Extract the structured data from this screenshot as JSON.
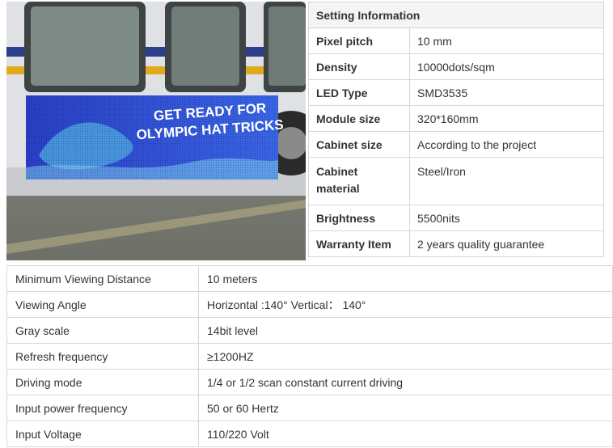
{
  "photo": {
    "sign_line1": "GET READY FOR",
    "sign_line2": "OLYMPIC HAT TRICKS"
  },
  "setting": {
    "header": "Setting Information",
    "rows": [
      {
        "key": "Pixel pitch",
        "value": "10 mm"
      },
      {
        "key": "Density",
        "value": "10000dots/sqm"
      },
      {
        "key": "LED Type",
        "value": "SMD3535"
      },
      {
        "key": "Module size",
        "value": "320*160mm"
      },
      {
        "key": "Cabinet size",
        "value": "According to the project"
      },
      {
        "key": "Cabinet material",
        "value": "Steel/Iron"
      },
      {
        "key": "Brightness",
        "value": "5500nits"
      },
      {
        "key": "Warranty Item",
        "value": "2 years quality guarantee"
      }
    ]
  },
  "specs": {
    "rows": [
      {
        "key": "Minimum Viewing Distance",
        "value": "10 meters"
      },
      {
        "key": "Viewing Angle",
        "value": "Horizontal :140° Vertical： 140°"
      },
      {
        "key": "Gray scale",
        "value": "14bit level"
      },
      {
        "key": "Refresh frequency",
        "value": "≥1200HZ"
      },
      {
        "key": "Driving mode",
        "value": "1/4 or 1/2 scan constant current driving"
      },
      {
        "key": "Input power frequency",
        "value": "50 or 60 Hertz"
      },
      {
        "key": "Input Voltage",
        "value": "110/220 Volt"
      }
    ]
  }
}
